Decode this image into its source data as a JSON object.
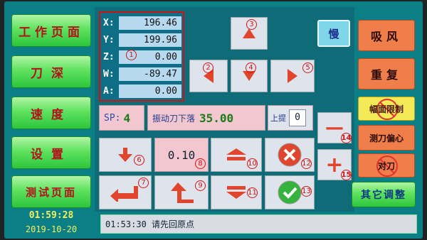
{
  "left_menu": {
    "work_page": "工作页面",
    "knife_depth": "刀深",
    "speed": "速度",
    "settings": "设置",
    "test_page": "测试页面"
  },
  "clock": {
    "time": "01:59:28",
    "date": "2019-10-20"
  },
  "coords": [
    {
      "label": "X:",
      "value": "196.46"
    },
    {
      "label": "Y:",
      "value": "199.96"
    },
    {
      "label": "Z:",
      "value": "0.00"
    },
    {
      "label": "W:",
      "value": "-89.47"
    },
    {
      "label": "A:",
      "value": "0.00"
    }
  ],
  "markers": {
    "n1": "1",
    "n2": "2",
    "n3": "3",
    "n4": "4",
    "n5": "5",
    "n6": "6",
    "n7": "7",
    "n8": "8",
    "n9": "9",
    "n10": "10",
    "n11": "11",
    "n12": "12",
    "n13": "13",
    "n14": "14",
    "n15": "15"
  },
  "sp": {
    "label": "SP:",
    "value": "4"
  },
  "vibration": {
    "label": "振动刀下落",
    "value": "35.00"
  },
  "lift": {
    "label": "上提",
    "value": "0"
  },
  "step": {
    "value": "0.10"
  },
  "slow": "慢",
  "right_menu": {
    "suction": "吸风",
    "repeat": "重复",
    "width_limit": "幅面限制",
    "knife_offset": "测刀偏心",
    "knife_align": "对刀",
    "other": "其它调整"
  },
  "minus": "—",
  "plus": "+",
  "status_text": "01:53:30 请先回原点",
  "colors": {
    "screen": "#0b7f86",
    "arrow_red": "#e0452e",
    "accent_green": "#5fe25f"
  },
  "icons": [
    "arrow-up-icon",
    "arrow-left-icon",
    "arrow-down-icon",
    "arrow-right-icon",
    "return-arrow-icon",
    "double-up-icon",
    "double-down-icon",
    "cancel-icon",
    "confirm-icon",
    "prohibit-icon"
  ]
}
